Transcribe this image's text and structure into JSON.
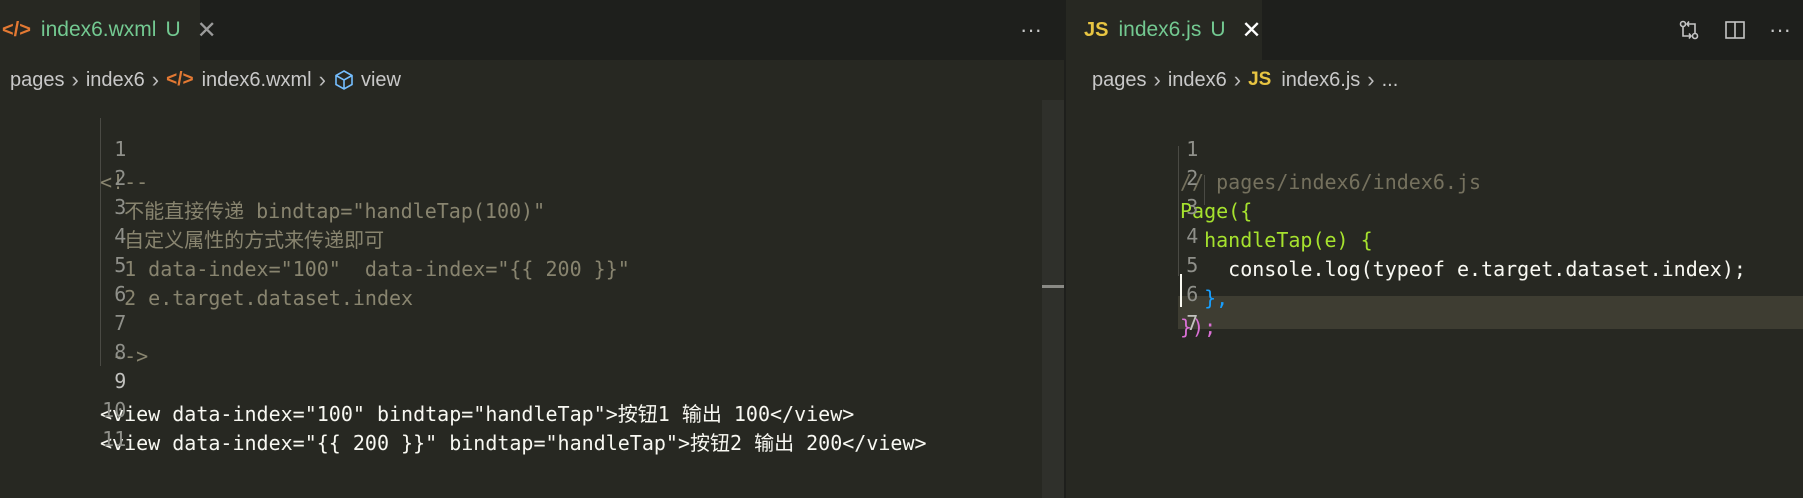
{
  "left": {
    "tab": {
      "icon": "</>",
      "name": "index6.wxml",
      "status": "U",
      "close": "✕"
    },
    "more": "···",
    "breadcrumb": [
      "pages",
      "index6",
      "index6.wxml",
      "view"
    ],
    "lines": [
      {
        "n": "1",
        "text": "<!--"
      },
      {
        "n": "2",
        "text": "  不能直接传递 bindtap=\"handleTap(100)\""
      },
      {
        "n": "3",
        "text": "  自定义属性的方式来传递即可"
      },
      {
        "n": "4",
        "text": "  1 data-index=\"100\"  data-index=\"{{ 200 }}\""
      },
      {
        "n": "5",
        "text": "  2 e.target.dataset.index"
      },
      {
        "n": "6",
        "text": ""
      },
      {
        "n": "7",
        "text": " -->"
      },
      {
        "n": "8",
        "text": ""
      },
      {
        "n": "9",
        "text": "<view data-index=\"100\" bindtap=\"handleTap\">按钮1 输出 100</view>"
      },
      {
        "n": "10",
        "text": "<view data-index=\"{{ 200 }}\" bindtap=\"handleTap\">按钮2 输出 200</view>"
      },
      {
        "n": "11",
        "text": ""
      }
    ]
  },
  "right": {
    "tab": {
      "icon": "JS",
      "name": "index6.js",
      "status": "U",
      "close": "✕"
    },
    "actions": [
      "compare-icon",
      "split-editor-icon",
      "more-icon"
    ],
    "breadcrumb": [
      "pages",
      "index6",
      "index6.js",
      "..."
    ],
    "lines": [
      {
        "n": "1",
        "text": "// pages/index6/index6.js"
      },
      {
        "n": "2",
        "text": "Page({"
      },
      {
        "n": "3",
        "text": "  handleTap(e) {"
      },
      {
        "n": "4",
        "text": "    console.log(typeof e.target.dataset.index);"
      },
      {
        "n": "5",
        "text": "  },"
      },
      {
        "n": "6",
        "text": "});"
      },
      {
        "n": "7",
        "text": ""
      }
    ]
  }
}
